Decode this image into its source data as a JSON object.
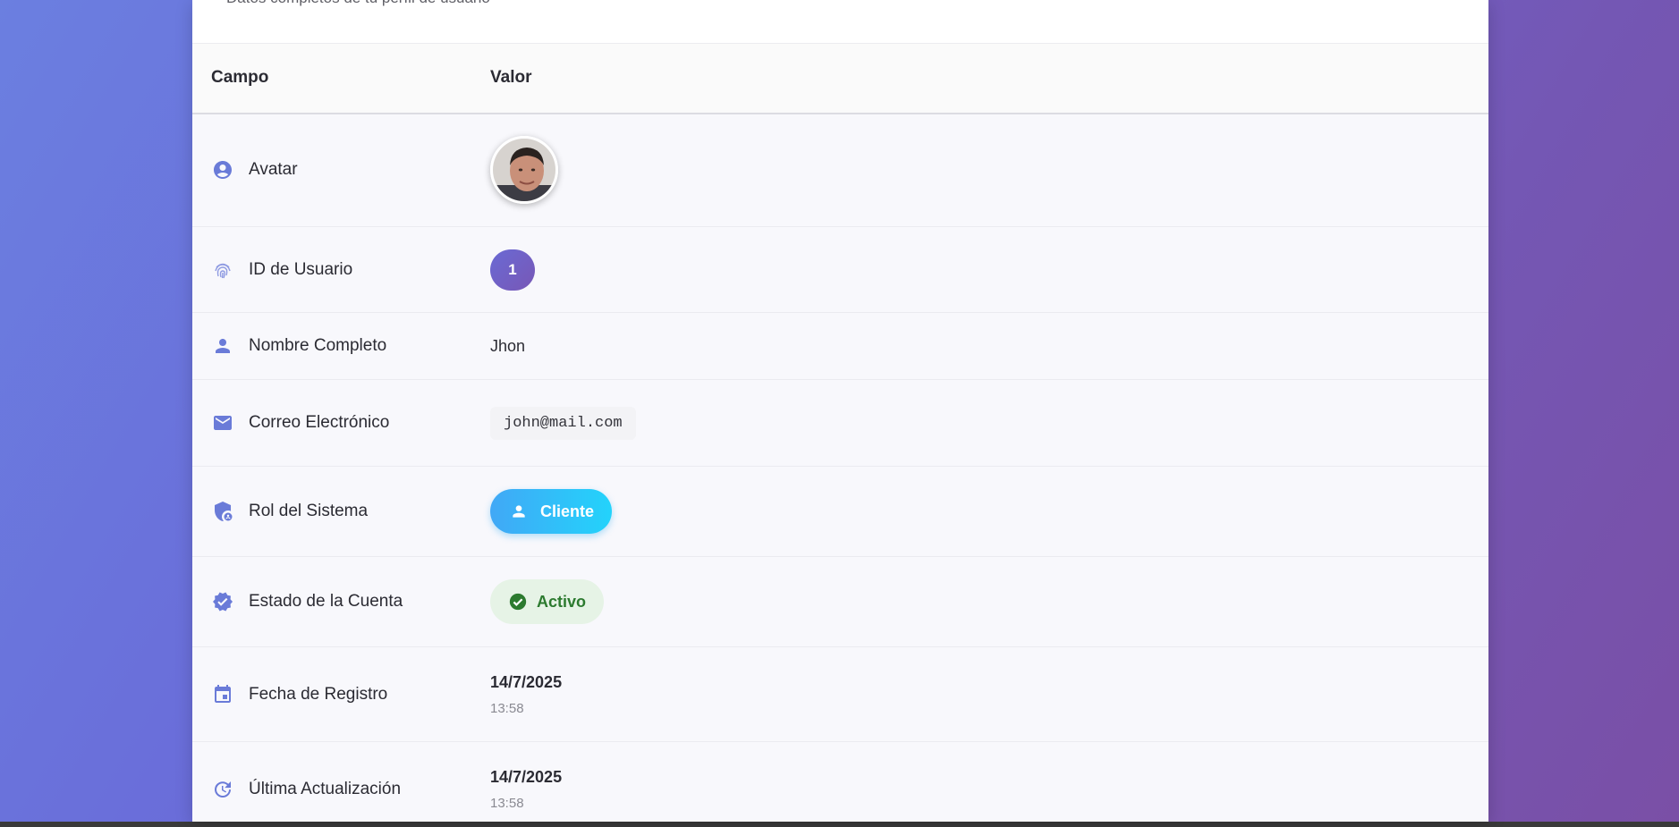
{
  "card": {
    "subtitle": "Datos completos de tu perfil de usuario"
  },
  "table": {
    "headers": {
      "field": "Campo",
      "value": "Valor"
    },
    "rows": [
      {
        "icon": "account-circle-icon",
        "label": "Avatar"
      },
      {
        "icon": "fingerprint-icon",
        "label": "ID de Usuario",
        "value": "1"
      },
      {
        "icon": "person-icon",
        "label": "Nombre Completo",
        "value": "Jhon"
      },
      {
        "icon": "mail-icon",
        "label": "Correo Electrónico",
        "value": "john@mail.com"
      },
      {
        "icon": "admin-shield-icon",
        "label": "Rol del Sistema",
        "value": "Cliente"
      },
      {
        "icon": "verified-badge-icon",
        "label": "Estado de la Cuenta",
        "value": "Activo"
      },
      {
        "icon": "calendar-icon",
        "label": "Fecha de Registro",
        "date": "14/7/2025",
        "time": "13:58"
      },
      {
        "icon": "update-icon",
        "label": "Última Actualización",
        "date": "14/7/2025",
        "time": "13:58"
      }
    ]
  },
  "colors": {
    "accent": "#6a7bd8",
    "role_chip": "#23d3fb",
    "status_active": "#2c7a2f"
  }
}
